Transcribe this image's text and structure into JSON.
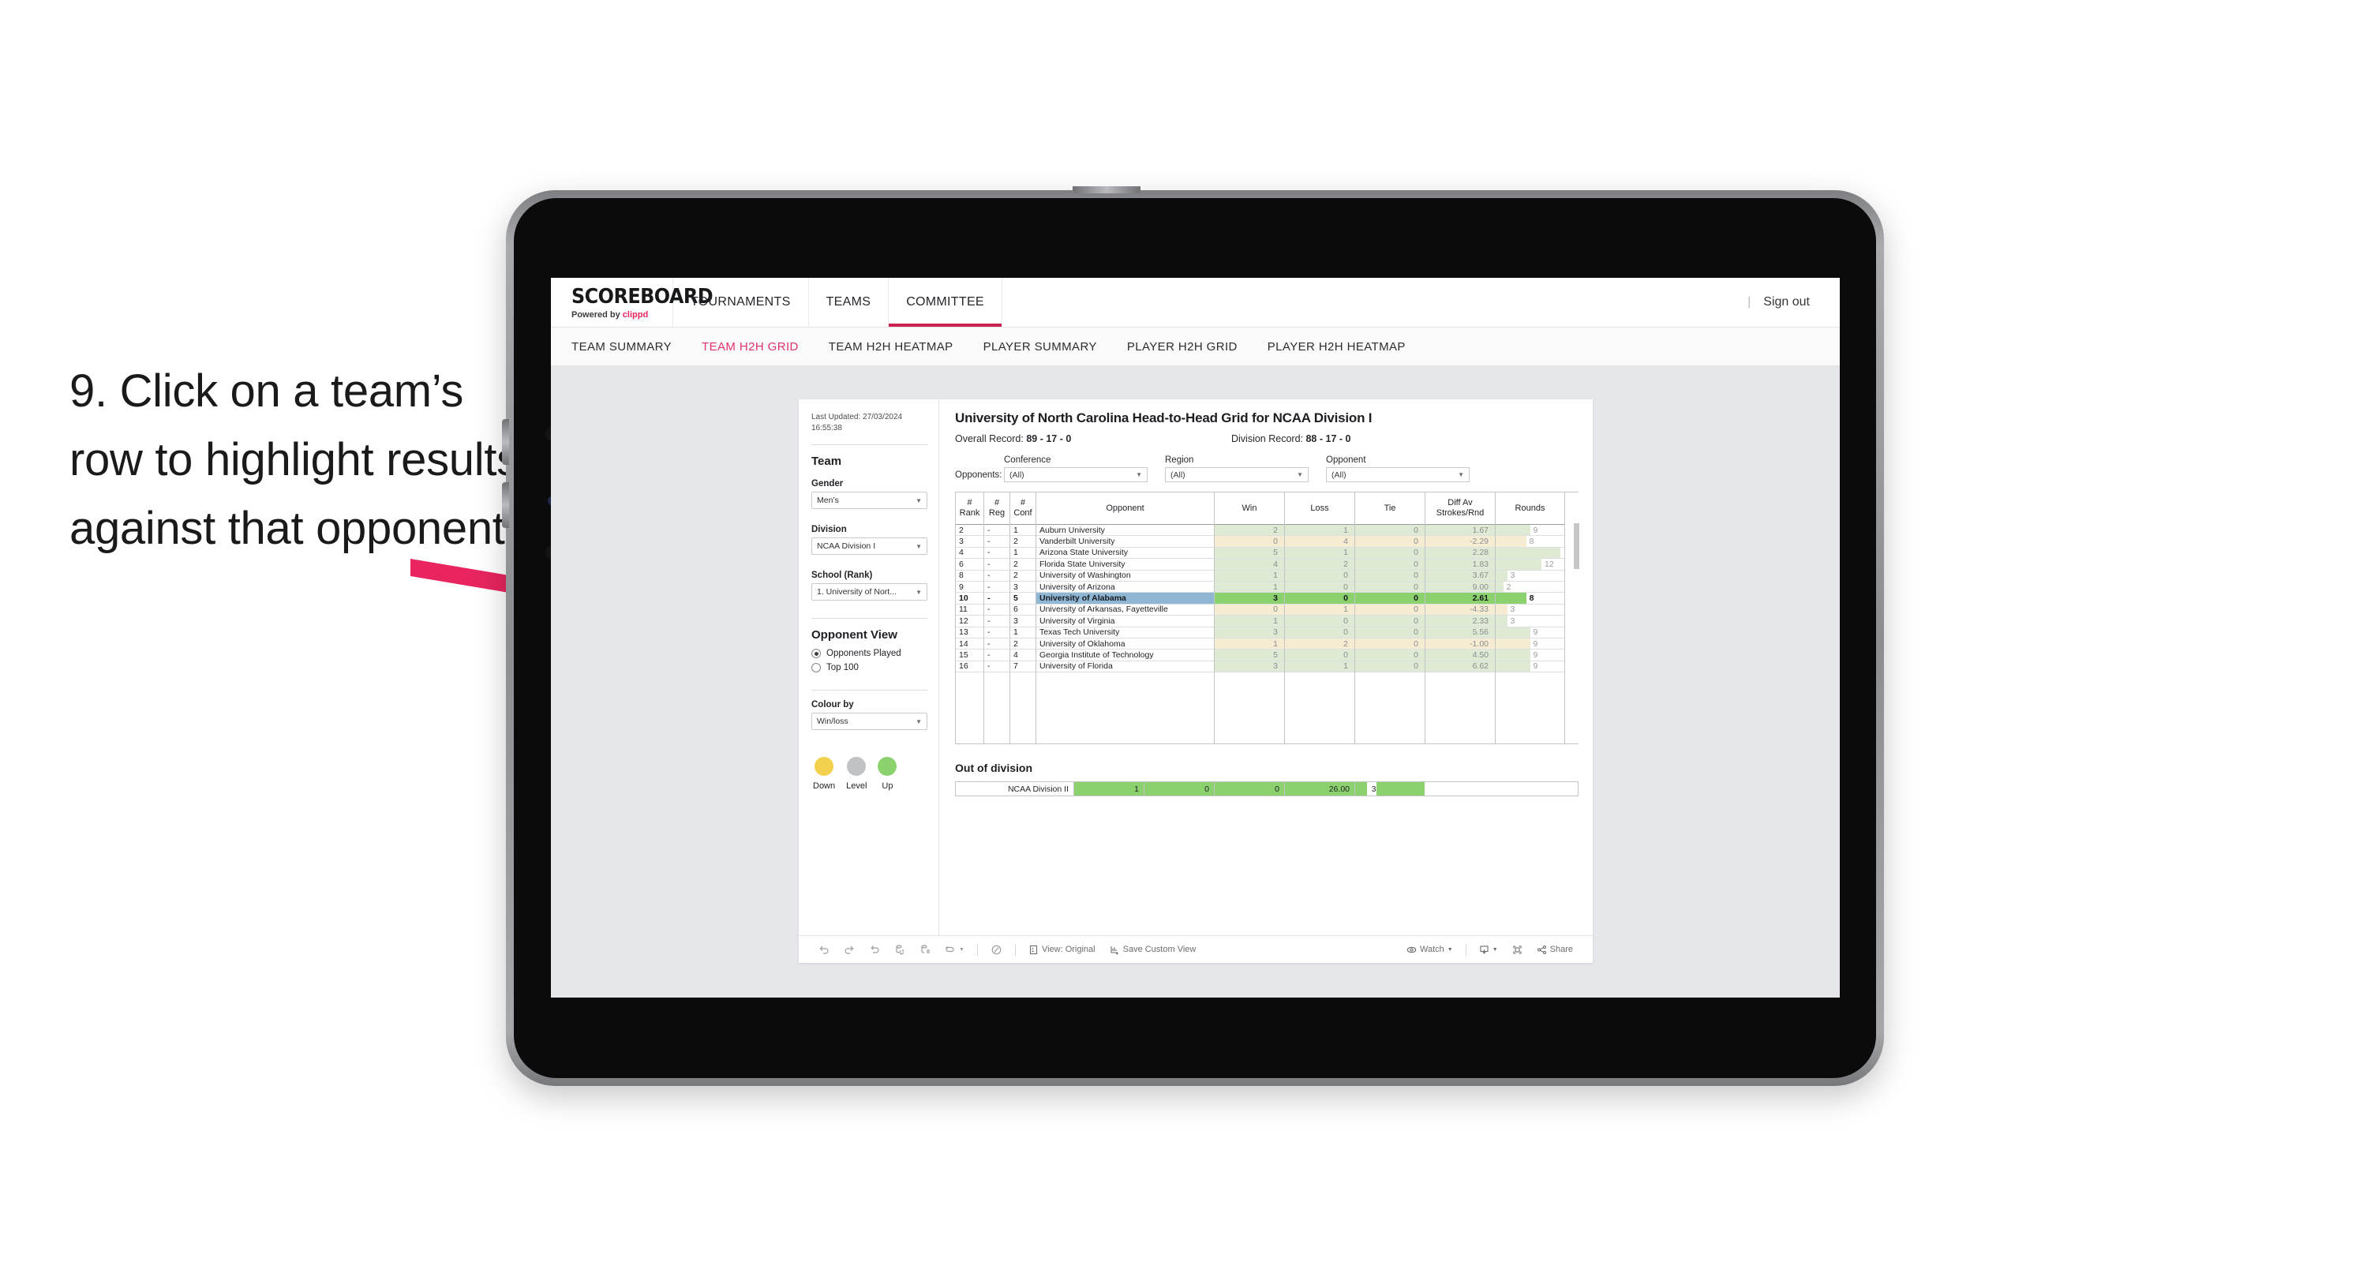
{
  "caption": {
    "text": "9. Click on a team’s row to highlight results against that opponent"
  },
  "app": {
    "brand_title": "SCOREBOARD",
    "brand_sub_prefix": "Powered by ",
    "brand_sub_accent": "clippd",
    "accent_color": "#e8255f",
    "topnav": [
      {
        "label": "TOURNAMENTS",
        "active": false
      },
      {
        "label": "TEAMS",
        "active": false
      },
      {
        "label": "COMMITTEE",
        "active": true
      }
    ],
    "signout_divider": "|",
    "signout_label": "Sign out",
    "subnav": [
      {
        "label": "TEAM SUMMARY",
        "active": false
      },
      {
        "label": "TEAM H2H GRID",
        "active": true
      },
      {
        "label": "TEAM H2H HEATMAP",
        "active": false
      },
      {
        "label": "PLAYER SUMMARY",
        "active": false
      },
      {
        "label": "PLAYER H2H GRID",
        "active": false
      },
      {
        "label": "PLAYER H2H HEATMAP",
        "active": false
      }
    ]
  },
  "filters": {
    "last_updated": "Last Updated: 27/03/2024 16:55:38",
    "team_heading": "Team",
    "gender_label": "Gender",
    "gender_value": "Men’s",
    "division_label": "Division",
    "division_value": "NCAA Division I",
    "school_label": "School (Rank)",
    "school_value": "1. University of Nort...",
    "opponent_view_heading": "Opponent View",
    "opponent_view_options": [
      {
        "label": "Opponents Played",
        "selected": true
      },
      {
        "label": "Top 100",
        "selected": false
      }
    ],
    "colour_by_label": "Colour by",
    "colour_by_value": "Win/loss",
    "legend": [
      {
        "label": "Down",
        "color": "#f3d14e"
      },
      {
        "label": "Level",
        "color": "#c0c2c5"
      },
      {
        "label": "Up",
        "color": "#8bd16e"
      }
    ]
  },
  "report": {
    "title": "University of North Carolina Head-to-Head Grid for NCAA Division I",
    "overall_record_label": "Overall Record: ",
    "overall_record_value": "89 - 17 - 0",
    "division_record_label": "Division Record: ",
    "division_record_value": "88 - 17 - 0",
    "opponents_label": "Opponents:",
    "dropdowns": [
      {
        "label": "Conference",
        "value": "(All)"
      },
      {
        "label": "Region",
        "value": "(All)"
      },
      {
        "label": "Opponent",
        "value": "(All)"
      }
    ]
  },
  "chart_data": {
    "type": "table",
    "title": "University of North Carolina Head-to-Head Grid for NCAA Division I",
    "columns": [
      "# Rank",
      "# Reg",
      "# Conf",
      "Opponent",
      "Win",
      "Loss",
      "Tie",
      "Diff Av Strokes/Rnd",
      "Rounds"
    ],
    "selected_row_index": 6,
    "rounds_axis_max": 18,
    "rows": [
      {
        "rank": "2",
        "reg": "-",
        "conf": "1",
        "opponent": "Auburn University",
        "win": "2",
        "loss": "1",
        "tie": "0",
        "diff": "1.67",
        "rounds": "9",
        "tone": "up",
        "selected": false
      },
      {
        "rank": "3",
        "reg": "-",
        "conf": "2",
        "opponent": "Vanderbilt University",
        "win": "0",
        "loss": "4",
        "tie": "0",
        "diff": "-2.29",
        "rounds": "8",
        "tone": "down",
        "selected": false
      },
      {
        "rank": "4",
        "reg": "-",
        "conf": "1",
        "opponent": "Arizona State University",
        "win": "5",
        "loss": "1",
        "tie": "0",
        "diff": "2.28",
        "rounds": "17",
        "tone": "up",
        "selected": false
      },
      {
        "rank": "6",
        "reg": "-",
        "conf": "2",
        "opponent": "Florida State University",
        "win": "4",
        "loss": "2",
        "tie": "0",
        "diff": "1.83",
        "rounds": "12",
        "tone": "up",
        "selected": false
      },
      {
        "rank": "8",
        "reg": "-",
        "conf": "2",
        "opponent": "University of Washington",
        "win": "1",
        "loss": "0",
        "tie": "0",
        "diff": "3.67",
        "rounds": "3",
        "tone": "up",
        "selected": false
      },
      {
        "rank": "9",
        "reg": "-",
        "conf": "3",
        "opponent": "University of Arizona",
        "win": "1",
        "loss": "0",
        "tie": "0",
        "diff": "9.00",
        "rounds": "2",
        "tone": "up",
        "selected": false
      },
      {
        "rank": "10",
        "reg": "-",
        "conf": "5",
        "opponent": "University of Alabama",
        "win": "3",
        "loss": "0",
        "tie": "0",
        "diff": "2.61",
        "rounds": "8",
        "tone": "up",
        "selected": true
      },
      {
        "rank": "11",
        "reg": "-",
        "conf": "6",
        "opponent": "University of Arkansas, Fayetteville",
        "win": "0",
        "loss": "1",
        "tie": "0",
        "diff": "-4.33",
        "rounds": "3",
        "tone": "down",
        "selected": false
      },
      {
        "rank": "12",
        "reg": "-",
        "conf": "3",
        "opponent": "University of Virginia",
        "win": "1",
        "loss": "0",
        "tie": "0",
        "diff": "2.33",
        "rounds": "3",
        "tone": "up",
        "selected": false
      },
      {
        "rank": "13",
        "reg": "-",
        "conf": "1",
        "opponent": "Texas Tech University",
        "win": "3",
        "loss": "0",
        "tie": "0",
        "diff": "5.56",
        "rounds": "9",
        "tone": "up",
        "selected": false
      },
      {
        "rank": "14",
        "reg": "-",
        "conf": "2",
        "opponent": "University of Oklahoma",
        "win": "1",
        "loss": "2",
        "tie": "0",
        "diff": "-1.00",
        "rounds": "9",
        "tone": "down",
        "selected": false
      },
      {
        "rank": "15",
        "reg": "-",
        "conf": "4",
        "opponent": "Georgia Institute of Technology",
        "win": "5",
        "loss": "0",
        "tie": "0",
        "diff": "4.50",
        "rounds": "9",
        "tone": "up",
        "selected": false
      },
      {
        "rank": "16",
        "reg": "-",
        "conf": "7",
        "opponent": "University of Florida",
        "win": "3",
        "loss": "1",
        "tie": "0",
        "diff": "6.62",
        "rounds": "9",
        "tone": "up",
        "selected": false
      }
    ]
  },
  "out_of_division": {
    "heading": "Out of division",
    "row": {
      "label": "NCAA Division II",
      "win": "1",
      "loss": "0",
      "tie": "0",
      "diff": "26.00",
      "rounds": "3"
    }
  },
  "toolbar": {
    "view_label": "View: Original",
    "save_label": "Save Custom View",
    "watch_label": "Watch",
    "share_label": "Share"
  }
}
